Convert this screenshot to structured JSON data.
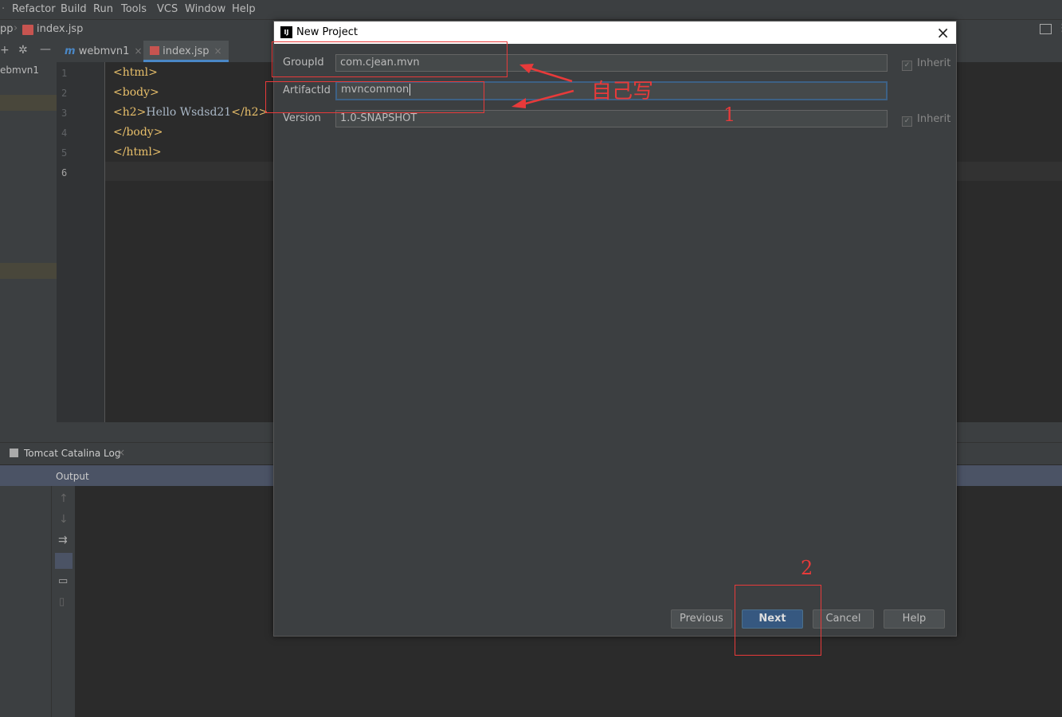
{
  "menubar": {
    "items": [
      {
        "label": "Refactor"
      },
      {
        "label": "Build"
      },
      {
        "label": "Run"
      },
      {
        "label": "Tools"
      },
      {
        "label": "VCS"
      },
      {
        "label": "Window"
      },
      {
        "label": "Help"
      }
    ]
  },
  "navbar": {
    "crumb_prefix": "pp",
    "file": "index.jsp"
  },
  "tabs": [
    {
      "label": "webmvn1"
    },
    {
      "label": "index.jsp"
    }
  ],
  "tree": {
    "item": "ebmvn1"
  },
  "editor": {
    "line_numbers": [
      "1",
      "2",
      "3",
      "4",
      "5",
      "6"
    ],
    "lines": [
      {
        "open": "<html>",
        "text": "",
        "close": ""
      },
      {
        "open": "<body>",
        "text": "",
        "close": ""
      },
      {
        "open": "<h2>",
        "text": "Hello Wsdsd21",
        "close": "</h2>"
      },
      {
        "open": "</body>",
        "text": "",
        "close": ""
      },
      {
        "open": "</html>",
        "text": "",
        "close": ""
      }
    ]
  },
  "bottom": {
    "tab_label": "Tomcat Catalina Log",
    "output_label": "Output"
  },
  "dialog": {
    "title": "New Project",
    "group_label": "GroupId",
    "group_value": "com.cjean.mvn",
    "artifact_label": "ArtifactId",
    "artifact_value": "mvncommon",
    "version_label": "Version",
    "version_value": "1.0-SNAPSHOT",
    "inherit_label": "Inherit",
    "buttons": {
      "previous": "Previous",
      "next": "Next",
      "cancel": "Cancel",
      "help": "Help"
    }
  },
  "annotations": {
    "note": "自己写",
    "step1": "1",
    "step2": "2"
  },
  "colors": {
    "annotation_red": "#e83a3a",
    "primary_button": "#365880",
    "dialog_bg": "#3c3f41",
    "editor_bg": "#2b2b2b"
  }
}
